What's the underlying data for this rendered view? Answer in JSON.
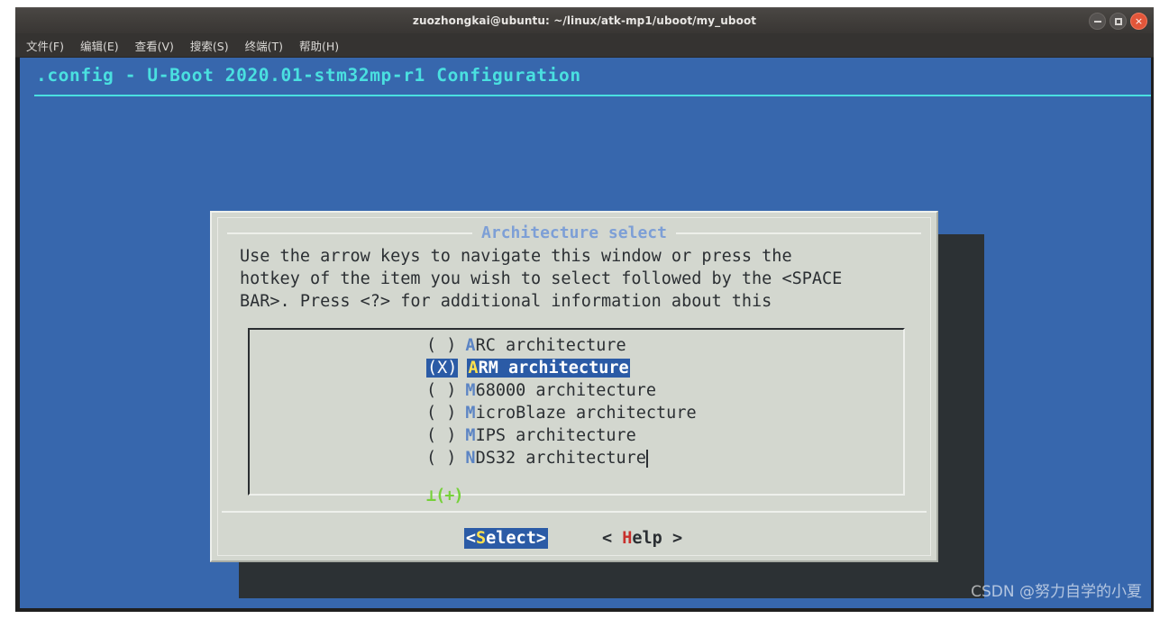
{
  "window": {
    "title": "zuozhongkai@ubuntu: ~/linux/atk-mp1/uboot/my_uboot",
    "controls": {
      "minimize": "minimize-button",
      "maximize": "maximize-button",
      "close": "×"
    }
  },
  "menubar": {
    "items": [
      {
        "label": "文件(F)"
      },
      {
        "label": "编辑(E)"
      },
      {
        "label": "查看(V)"
      },
      {
        "label": "搜索(S)"
      },
      {
        "label": "终端(T)"
      },
      {
        "label": "帮助(H)"
      }
    ]
  },
  "terminal": {
    "config_header": ".config - U-Boot 2020.01-stm32mp-r1 Configuration",
    "background_color": "#3767ad",
    "header_color": "#4ae0e0"
  },
  "dialog": {
    "title": "Architecture select",
    "title_color": "#7d9fd6",
    "background_color": "#d3d7cf",
    "help_text": "Use the arrow keys to navigate this window or press the\nhotkey of the item you wish to select followed by the <SPACE\nBAR>. Press <?> for additional information about this",
    "list": {
      "items": [
        {
          "marker": "( )",
          "hotkey": "A",
          "rest": "RC architecture",
          "selected": false
        },
        {
          "marker": "(X)",
          "hotkey": "A",
          "rest": "RM architecture",
          "selected": true
        },
        {
          "marker": "( )",
          "hotkey": "M",
          "rest": "68000 architecture",
          "selected": false
        },
        {
          "marker": "( )",
          "hotkey": "M",
          "rest": "icroBlaze architecture",
          "selected": false
        },
        {
          "marker": "( )",
          "hotkey": "M",
          "rest": "IPS architecture",
          "selected": false
        },
        {
          "marker": "( )",
          "hotkey": "N",
          "rest": "DS32 architecture",
          "selected": false
        }
      ],
      "scroll_indicator": "⊥(+)",
      "scroll_indicator_color": "#76d13a",
      "selection_color": "#2b5ba6",
      "hotkey_color": "#5b84c4",
      "selected_hotkey_color": "#ffe14d"
    },
    "buttons": [
      {
        "prefix": "<",
        "hotkey": "S",
        "rest": "elect>",
        "active": true
      },
      {
        "prefix": "< ",
        "hotkey": "H",
        "rest": "elp >",
        "active": false
      }
    ]
  },
  "watermark": {
    "text": "CSDN @努力自学的小夏"
  }
}
